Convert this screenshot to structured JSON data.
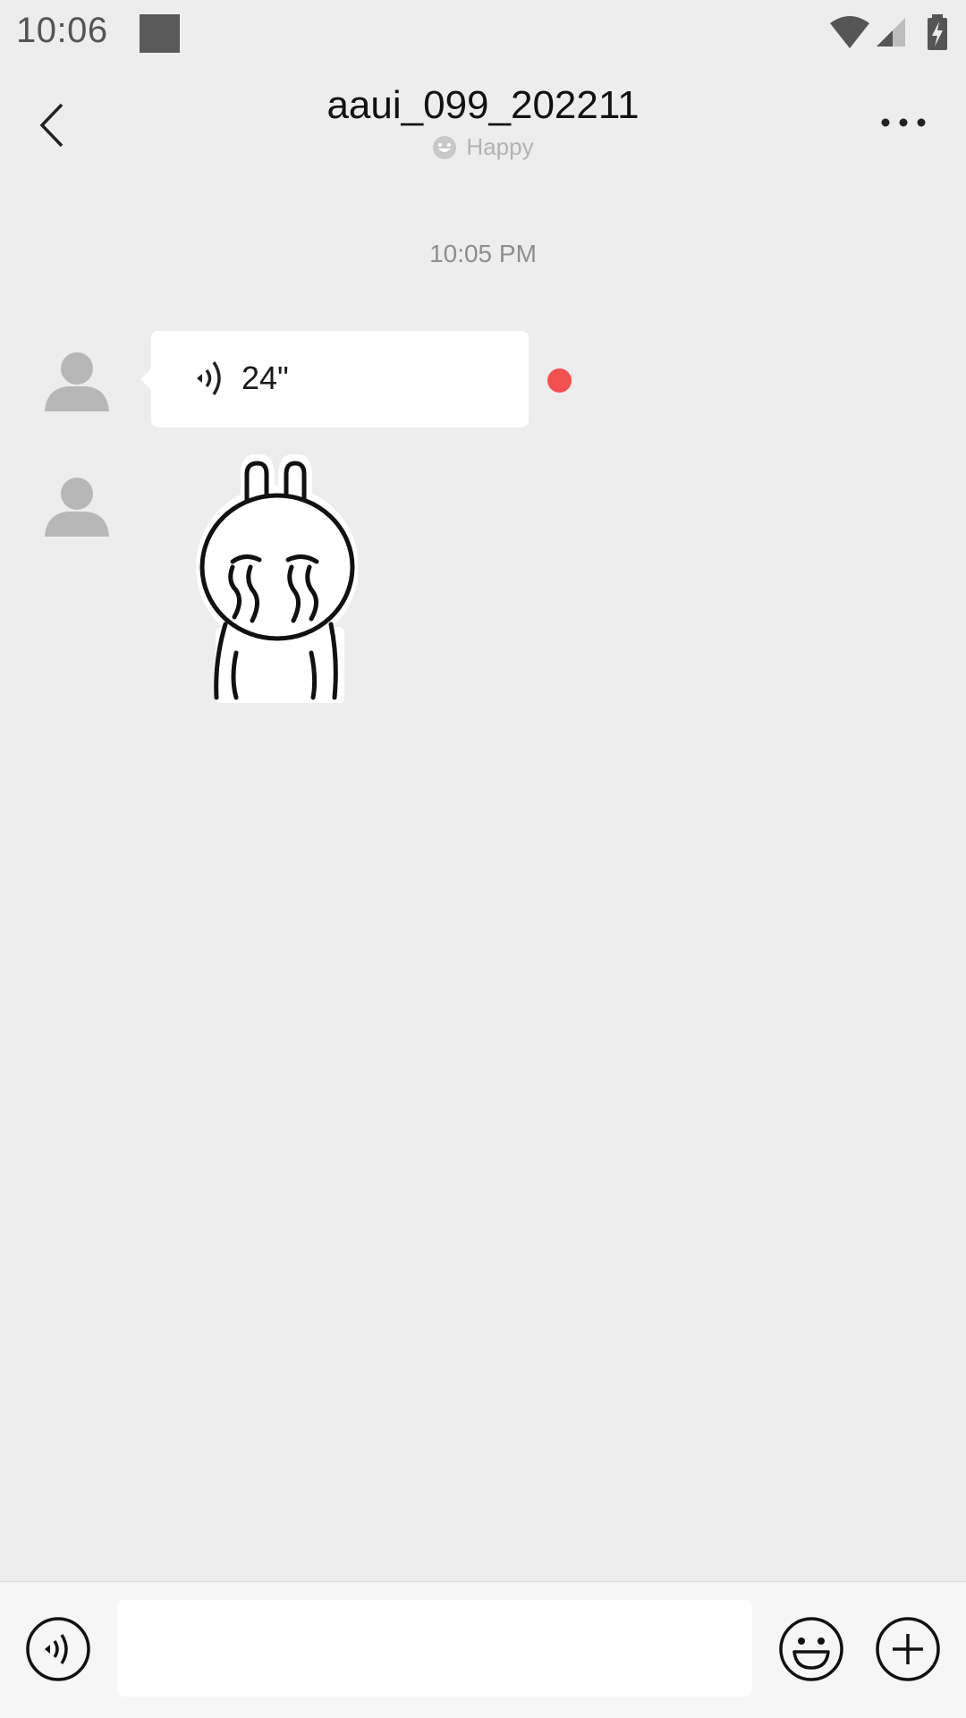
{
  "status_bar": {
    "time": "10:06",
    "icons": [
      "wifi-icon",
      "cellular-signal-icon",
      "battery-charging-icon"
    ]
  },
  "header": {
    "title": "aaui_099_202211",
    "status_text": "Happy",
    "status_icon": "smile-face-icon"
  },
  "chat": {
    "timestamp": "10:05 PM",
    "messages": [
      {
        "type": "voice",
        "duration": "24\"",
        "unread": true,
        "unread_color": "#f35050"
      },
      {
        "type": "sticker",
        "sticker": "crying-rabbit-sticker"
      }
    ]
  },
  "input_bar": {
    "text_value": "",
    "icons": [
      "voice-toggle-icon",
      "emoji-icon",
      "plus-icon"
    ]
  },
  "colors": {
    "background": "#ededed",
    "bubble": "#ffffff",
    "unread_dot": "#f35050"
  }
}
